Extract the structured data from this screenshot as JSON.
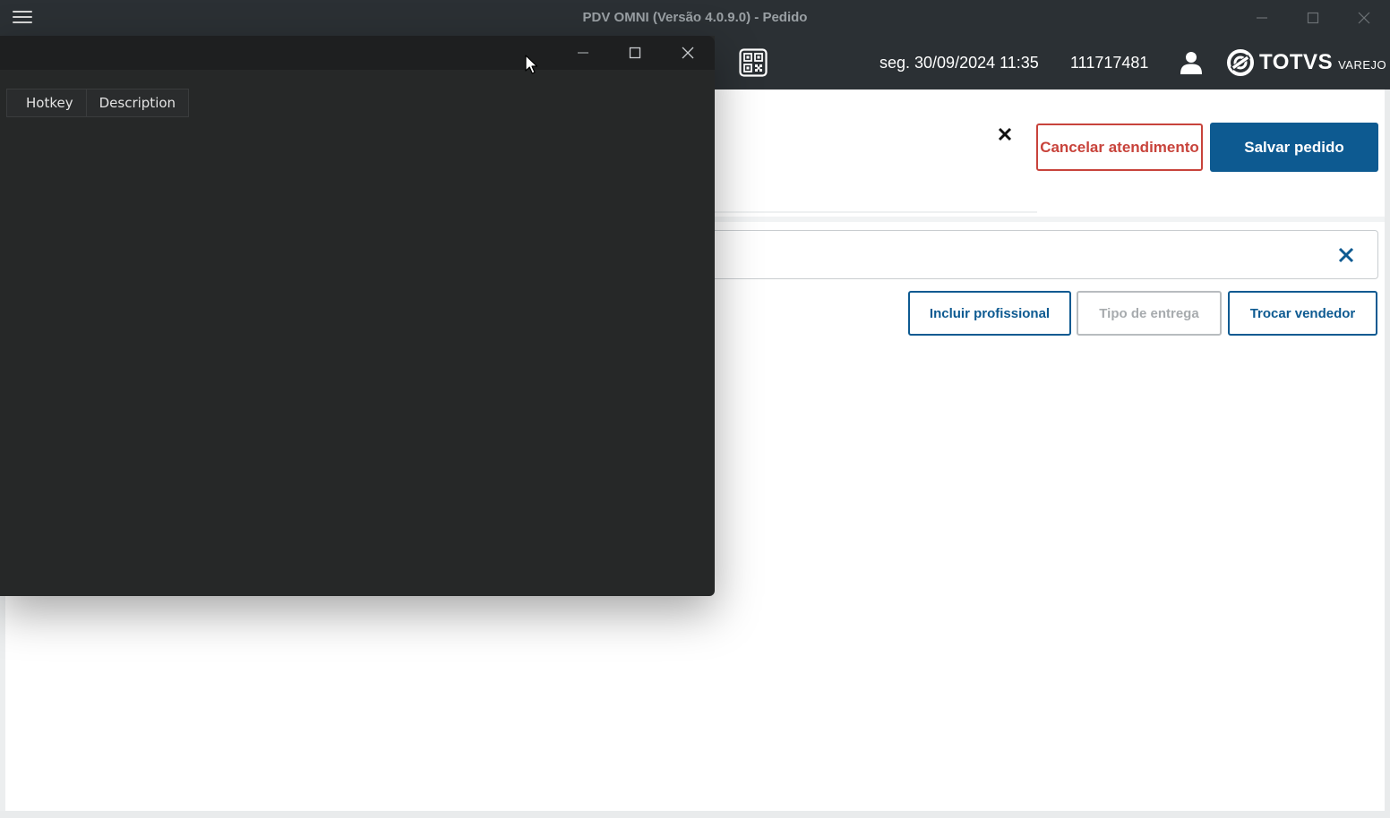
{
  "window": {
    "title": "PDV OMNI (Versão 4.0.9.0) - Pedido"
  },
  "header": {
    "datetime": "seg. 30/09/2024 11:35",
    "user_code": "111717481",
    "logo_text": "TOTVS",
    "logo_sub": "VAREJO"
  },
  "actions": {
    "cancel_label": "Cancelar atendimento",
    "save_label": "Salvar pedido"
  },
  "secondary_actions": {
    "incluir_label": "Incluir profissional",
    "tipo_label": "Tipo de entrega",
    "trocar_label": "Trocar vendedor"
  },
  "overlay": {
    "tabs": [
      {
        "label": "Hotkey"
      },
      {
        "label": "Description"
      }
    ]
  },
  "colors": {
    "header_bg": "#2b3034",
    "primary": "#0d5a91",
    "danger": "#c8433b",
    "overlay_bg": "#262828"
  },
  "icons": {
    "menu": "hamburger-icon",
    "qr": "qr-code-icon",
    "user": "person-icon",
    "close": "close-icon"
  }
}
